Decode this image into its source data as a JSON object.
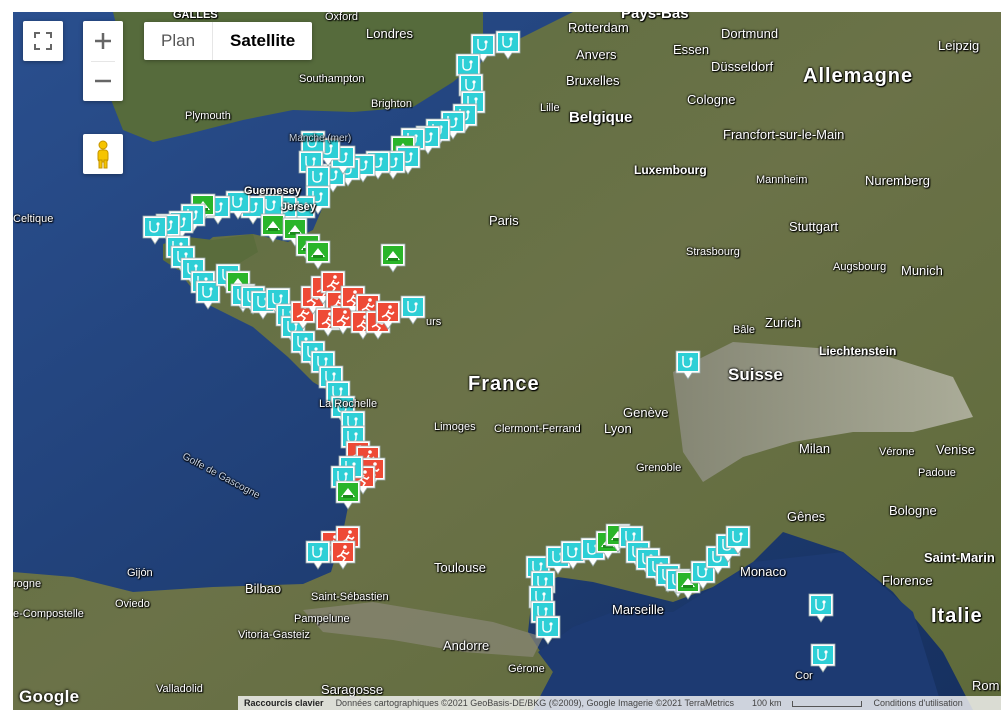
{
  "controls": {
    "fullscreen_icon": "fullscreen-icon",
    "zoom_in_icon": "plus-icon",
    "zoom_out_icon": "minus-icon",
    "pegman_icon": "pegman-icon",
    "map_type": {
      "plan": "Plan",
      "satellite": "Satellite",
      "selected": "Satellite"
    }
  },
  "labels": {
    "countries": {
      "allemagne": "Allemagne",
      "belgique": "Belgique",
      "france": "France",
      "suisse": "Suisse",
      "italie": "Italie",
      "liechtenstein": "Liechtenstein",
      "luxembourg": "Luxembourg",
      "galles": "GALLES",
      "pays_bas": "Pays-Bas"
    },
    "cities": {
      "oxford": "Oxford",
      "londres": "Londres",
      "rotterdam": "Rotterdam",
      "dortmund": "Dortmund",
      "anvers": "Anvers",
      "essen": "Essen",
      "leipzig": "Leipzig",
      "dusseldorf": "Düsseldorf",
      "southampton": "Southampton",
      "bruxelles": "Bruxelles",
      "cologne": "Cologne",
      "brighton": "Brighton",
      "plymouth": "Plymouth",
      "lille": "Lille",
      "francfort": "Francfort-sur-le-Main",
      "mannheim": "Mannheim",
      "nuremberg": "Nuremberg",
      "guernesey": "Guernesey",
      "jersey": "Jersey",
      "paris": "Paris",
      "stuttgart": "Stuttgart",
      "strasbourg": "Strasbourg",
      "augsbourg": "Augsbourg",
      "munich": "Munich",
      "zurich": "Zurich",
      "bale": "Bâle",
      "tours": "urs",
      "la_rochelle": "La Rochelle",
      "limoges": "Limoges",
      "clermont": "Clermont-Ferrand",
      "lyon": "Lyon",
      "geneve": "Genève",
      "milan": "Milan",
      "verone": "Vérone",
      "venise": "Venise",
      "padoue": "Padoue",
      "grenoble": "Grenoble",
      "genes": "Gênes",
      "bologne": "Bologne",
      "saint_marin": "Saint-Marin",
      "florence": "Florence",
      "toulouse": "Toulouse",
      "marseille": "Marseille",
      "monaco": "Monaco",
      "bilbao": "Bilbao",
      "saint_sebastien": "Saint-Sébastien",
      "gijon": "Gijón",
      "oviedo": "Oviedo",
      "coruna": "rogne",
      "compostelle": "e-Compostelle",
      "pampelune": "Pampelune",
      "vitoria": "Vitoria-Gasteiz",
      "andorre": "Andorre",
      "gerone": "Gérone",
      "valladolid": "Valladolid",
      "saragosse": "Saragosse",
      "rome": "Rom",
      "corse": "Cor",
      "celtique": "Celtique",
      "golfe": "Golfe de Gascogne",
      "manche": "Manche (mer)"
    }
  },
  "markers": {
    "legend_icons": [
      "stethoscope-icon",
      "spa-building-icon",
      "runner-icon"
    ],
    "colors": {
      "stethoscope": "#2ecfd6",
      "spa": "#2ab52a",
      "runner": "#ee4a36"
    }
  },
  "footer": {
    "logo": "Google",
    "shortcuts": "Raccourcis clavier",
    "attribution": "Données cartographiques ©2021 GeoBasis-DE/BKG (©2009), Google Imagerie ©2021 TerraMetrics",
    "scale": "100 km",
    "terms": "Conditions d'utilisation"
  }
}
